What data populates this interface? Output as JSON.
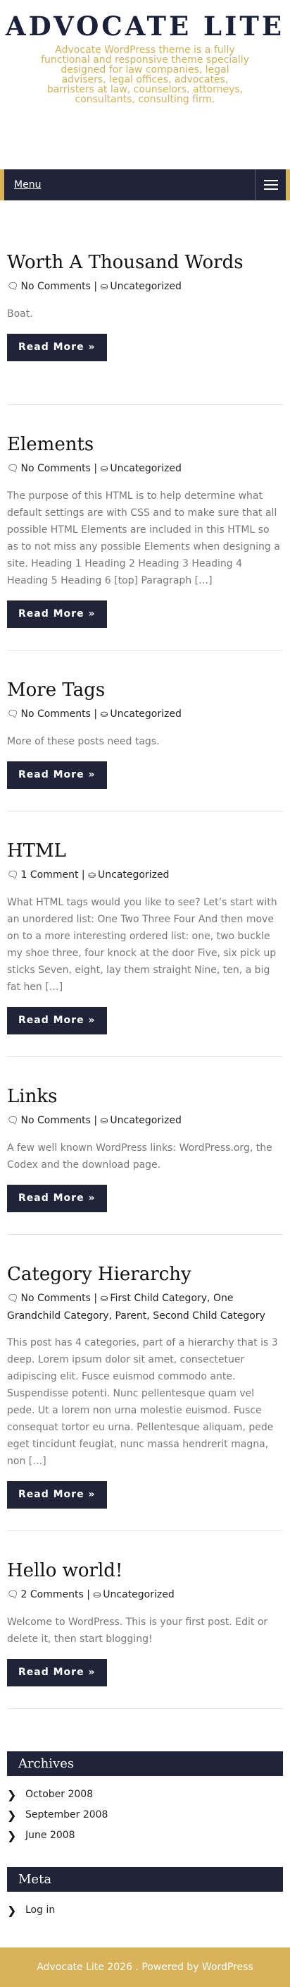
{
  "site": {
    "title": "ADVOCATE LITE",
    "tagline": "Advocate WordPress theme is a fully functional and responsive theme specially designed for law companies, legal advisers, legal offices, advocates, barristers at law, counselors, attorneys, consultants, consulting firm."
  },
  "nav": {
    "menu_label": "Menu"
  },
  "read_more_label": "Read More »",
  "posts": [
    {
      "title": "Worth A Thousand Words",
      "comments": "No Comments",
      "categories": "Uncategorized",
      "excerpt": "Boat."
    },
    {
      "title": "Elements",
      "comments": "No Comments",
      "categories": "Uncategorized",
      "excerpt": "The purpose of this HTML is to help determine what default settings are with CSS and to make sure that all possible HTML Elements are included in this HTML so as to not miss any possible Elements when designing a site. Heading 1 Heading 2 Heading 3 Heading 4 Heading 5 Heading 6 [top] Paragraph […]"
    },
    {
      "title": "More Tags",
      "comments": "No Comments",
      "categories": "Uncategorized",
      "excerpt": "More of these posts need tags."
    },
    {
      "title": "HTML",
      "comments": "1 Comment",
      "categories": "Uncategorized",
      "excerpt": "What HTML tags would you like to see? Let’s start with an unordered list: One Two Three Four And then move on to a more interesting ordered list: one, two buckle my shoe three, four knock at the door Five, six pick up sticks Seven, eight, lay them straight Nine, ten, a big fat hen […]"
    },
    {
      "title": "Links",
      "comments": "No Comments",
      "categories": "Uncategorized",
      "excerpt": "A few well known WordPress links: WordPress.org, the Codex and the download page."
    },
    {
      "title": "Category Hierarchy",
      "comments": "No Comments",
      "categories": "First Child Category, One Grandchild Category, Parent, Second Child Category",
      "excerpt": "This post has 4 categories, part of a hierarchy that is 3 deep. Lorem ipsum dolor sit amet, consectetuer adipiscing elit. Fusce euismod commodo ante. Suspendisse potenti. Nunc pellentesque quam vel pede. Ut a lorem non urna molestie euismod. Fusce consequat tortor eu urna. Pellentesque aliquam, pede eget tincidunt feugiat, nunc massa hendrerit magna, non […]"
    },
    {
      "title": "Hello world!",
      "comments": "2 Comments",
      "categories": "Uncategorized",
      "excerpt": "Welcome to WordPress. This is your first post. Edit or delete it, then start blogging!"
    }
  ],
  "sidebar": {
    "archives_title": "Archives",
    "archives": [
      "October 2008",
      "September 2008",
      "June 2008"
    ],
    "meta_title": "Meta",
    "meta": [
      "Log in"
    ]
  },
  "footer": {
    "text": "Advocate Lite 2026 . Powered by WordPress"
  },
  "colors": {
    "navy": "#1f2438",
    "gold": "#d9b25c"
  }
}
